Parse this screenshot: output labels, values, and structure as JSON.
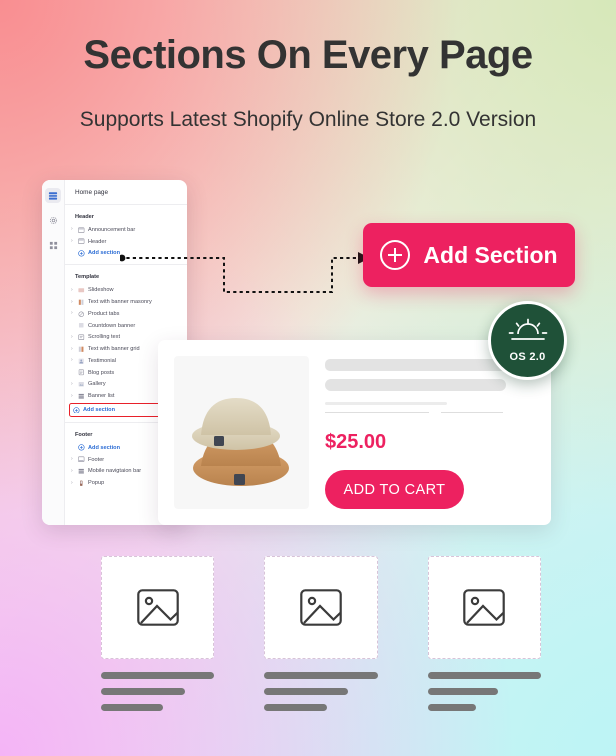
{
  "heading": {
    "title": "Sections On Every Page",
    "subtitle": "Supports Latest Shopify Online Store 2.0 Version"
  },
  "colors": {
    "accent_pink": "#ed2160",
    "badge_green": "#1f5138",
    "link_blue": "#2b6cd4",
    "highlight_red": "#e8202a"
  },
  "editor": {
    "rail": [
      {
        "name": "sections-rail-icon",
        "label": "Sections",
        "active": true
      },
      {
        "name": "settings-rail-icon",
        "label": "Theme settings",
        "active": false
      },
      {
        "name": "apps-rail-icon",
        "label": "Apps",
        "active": false
      }
    ],
    "page_title": "Home page",
    "groups": [
      {
        "label": "Header",
        "items": [
          {
            "label": "Announcement bar",
            "caret": true,
            "icon": "announcement-bar-icon",
            "type": "section"
          },
          {
            "label": "Header",
            "caret": true,
            "icon": "header-icon",
            "type": "section"
          },
          {
            "label": "Add section",
            "caret": false,
            "icon": "plus-circle-icon",
            "type": "add"
          }
        ]
      },
      {
        "label": "Template",
        "items": [
          {
            "label": "Slideshow",
            "caret": true,
            "icon": "slideshow-icon",
            "type": "section"
          },
          {
            "label": "Text with banner masonry",
            "caret": true,
            "icon": "banner-masonry-icon",
            "type": "section"
          },
          {
            "label": "Product tabs",
            "caret": true,
            "icon": "product-tabs-icon",
            "type": "section"
          },
          {
            "label": "Countdown banner",
            "caret": false,
            "icon": "countdown-banner-icon",
            "type": "section"
          },
          {
            "label": "Scrolling text",
            "caret": true,
            "icon": "scrolling-text-icon",
            "type": "section"
          },
          {
            "label": "Text with banner grid",
            "caret": true,
            "icon": "banner-grid-icon",
            "type": "section"
          },
          {
            "label": "Testimonial",
            "caret": true,
            "icon": "testimonial-icon",
            "type": "section"
          },
          {
            "label": "Blog posts",
            "caret": false,
            "icon": "blog-posts-icon",
            "type": "section"
          },
          {
            "label": "Gallery",
            "caret": true,
            "icon": "gallery-icon",
            "type": "section"
          },
          {
            "label": "Banner list",
            "caret": true,
            "icon": "banner-list-icon",
            "type": "section"
          },
          {
            "label": "Add section",
            "caret": false,
            "icon": "plus-circle-icon",
            "type": "add",
            "highlighted": true
          }
        ]
      },
      {
        "label": "Footer",
        "items": [
          {
            "label": "Add section",
            "caret": false,
            "icon": "plus-circle-icon",
            "type": "add"
          },
          {
            "label": "Footer",
            "caret": true,
            "icon": "footer-icon",
            "type": "section"
          },
          {
            "label": "Mobile navigtaion bar",
            "caret": true,
            "icon": "mobile-nav-icon",
            "type": "section"
          },
          {
            "label": "Popup",
            "caret": true,
            "icon": "popup-icon",
            "type": "section"
          }
        ]
      }
    ]
  },
  "cta": {
    "label": "Add Section",
    "icon": "plus-circle-icon"
  },
  "badge": {
    "label": "OS 2.0",
    "icon": "sunrise-icon"
  },
  "product": {
    "image_alt": "bucket-hats-photo",
    "price": "$25.00",
    "add_to_cart_label": "ADD TO CART"
  },
  "bottom_cards": [
    {
      "icon": "image-placeholder-icon",
      "line_widths": [
        "100%",
        "74%",
        "55%"
      ]
    },
    {
      "icon": "image-placeholder-icon",
      "line_widths": [
        "100%",
        "74%",
        "55%"
      ]
    },
    {
      "icon": "image-placeholder-icon",
      "line_widths": [
        "100%",
        "62%",
        "43%"
      ]
    }
  ]
}
